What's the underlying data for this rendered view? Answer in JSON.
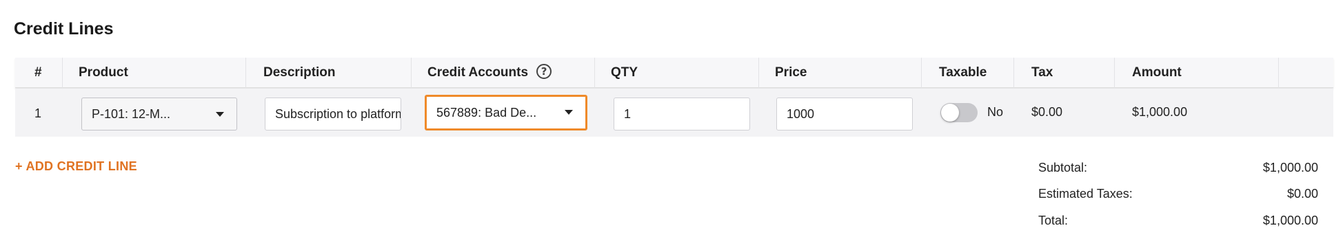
{
  "section": {
    "title": "Credit Lines"
  },
  "table": {
    "headers": {
      "index": "#",
      "product": "Product",
      "description": "Description",
      "credit_accounts": "Credit Accounts",
      "qty": "QTY",
      "price": "Price",
      "taxable": "Taxable",
      "tax": "Tax",
      "amount": "Amount"
    },
    "rows": [
      {
        "index": "1",
        "product": "P-101: 12-M...",
        "description": "Subscription to platform",
        "credit_account": "567889: Bad De...",
        "qty": "1",
        "price": "1000",
        "taxable_label": "No",
        "taxable_on": false,
        "tax": "$0.00",
        "amount": "$1,000.00"
      }
    ]
  },
  "actions": {
    "add_line": "+ ADD CREDIT LINE"
  },
  "totals": {
    "subtotal_label": "Subtotal:",
    "subtotal_value": "$1,000.00",
    "taxes_label": "Estimated Taxes:",
    "taxes_value": "$0.00",
    "total_label": "Total:",
    "total_value": "$1,000.00"
  },
  "colors": {
    "accent": "#e07322",
    "focus_border": "#ef8a2a",
    "toggle_off": "#c8c8cc"
  },
  "icons": {
    "help": "question-circle-icon",
    "dropdown": "caret-down-icon"
  }
}
